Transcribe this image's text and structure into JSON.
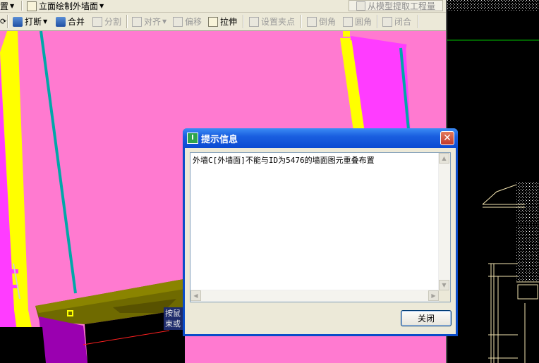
{
  "toolbar_top": {
    "item_1": "设置",
    "item_1_visible": "置",
    "item_2": "立面绘制外墙面",
    "search_placeholder": "从模型提取工程量"
  },
  "toolbar_edit": {
    "break": "打断",
    "merge": "合并",
    "split": "分割",
    "align": "对齐",
    "offset": "偏移",
    "stretch": "拉伸",
    "set_grip": "设置夹点",
    "chamfer": "倒角",
    "fillet": "圆角",
    "close": "闭合"
  },
  "cursor_tip": {
    "line1": "按鼠",
    "line2": "束或"
  },
  "dialog": {
    "title": "提示信息",
    "message": "外墙C[外墙面]不能与ID为5476的墙面图元重叠布置",
    "close_button": "关闭"
  },
  "colors": {
    "canvas_pink": "#ff7ad0",
    "wall_magenta": "#ff3cff",
    "wall_yellow": "#ffff00",
    "slab_olive": "#6f6a00",
    "line_cyan": "#00a8a8",
    "dialog_blue": "#0a4cc9"
  },
  "icons": {
    "break": "break-icon",
    "merge": "merge-icon",
    "search": "search-icon",
    "close": "close-icon"
  }
}
